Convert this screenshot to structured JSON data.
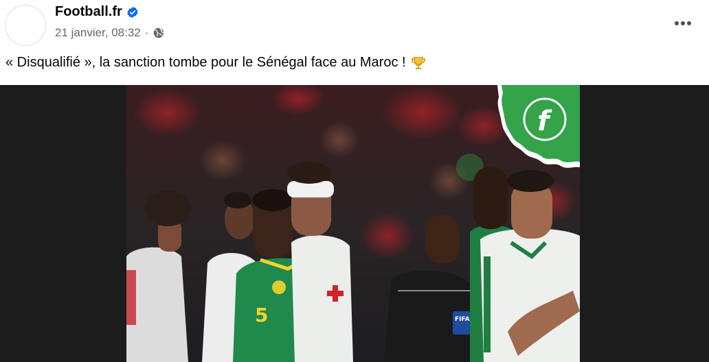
{
  "post": {
    "page_name": "Football.fr",
    "verified_icon": "verified-badge-icon",
    "timestamp": "21 janvier, 08:32",
    "separator": "·",
    "audience_icon": "globe-icon",
    "more_icon": "more-options-icon",
    "caption": "« Disqualifié », la sanction tombe pour le Sénégal face au Maroc !",
    "caption_emoji": "trophy-icon"
  },
  "photo": {
    "logo_letter": "f",
    "jersey_number": "5",
    "badge_text": "FIFA",
    "colors": {
      "logo_green": "#34a34a",
      "senegal_green": "#1f8a4c",
      "morocco_white": "#eef0ee",
      "referee_black": "#1a1a1a",
      "background": "#1c1c1c"
    }
  }
}
